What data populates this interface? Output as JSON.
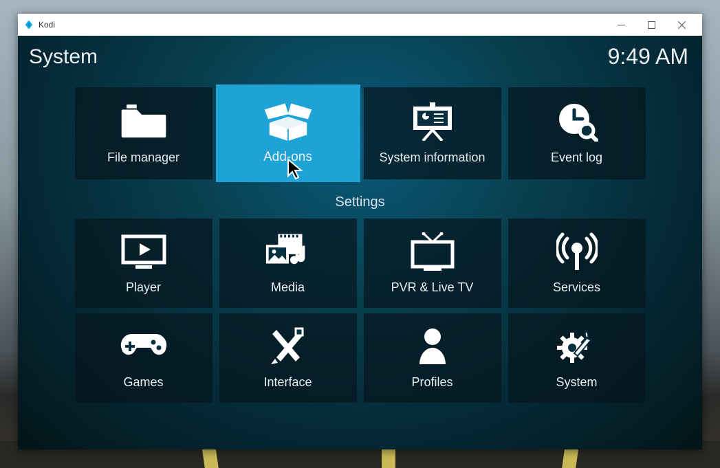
{
  "window_title": "Kodi",
  "header": {
    "title": "System",
    "clock": "9:49 AM"
  },
  "section_label": "Settings",
  "tiles_top": [
    {
      "id": "file-manager",
      "label": "File manager"
    },
    {
      "id": "addons",
      "label": "Add-ons",
      "selected": true
    },
    {
      "id": "system-information",
      "label": "System information"
    },
    {
      "id": "event-log",
      "label": "Event log"
    }
  ],
  "tiles_bottom": [
    {
      "id": "player",
      "label": "Player"
    },
    {
      "id": "media",
      "label": "Media"
    },
    {
      "id": "pvr",
      "label": "PVR & Live TV"
    },
    {
      "id": "services",
      "label": "Services"
    },
    {
      "id": "games",
      "label": "Games"
    },
    {
      "id": "interface",
      "label": "Interface"
    },
    {
      "id": "profiles",
      "label": "Profiles"
    },
    {
      "id": "system",
      "label": "System"
    }
  ]
}
